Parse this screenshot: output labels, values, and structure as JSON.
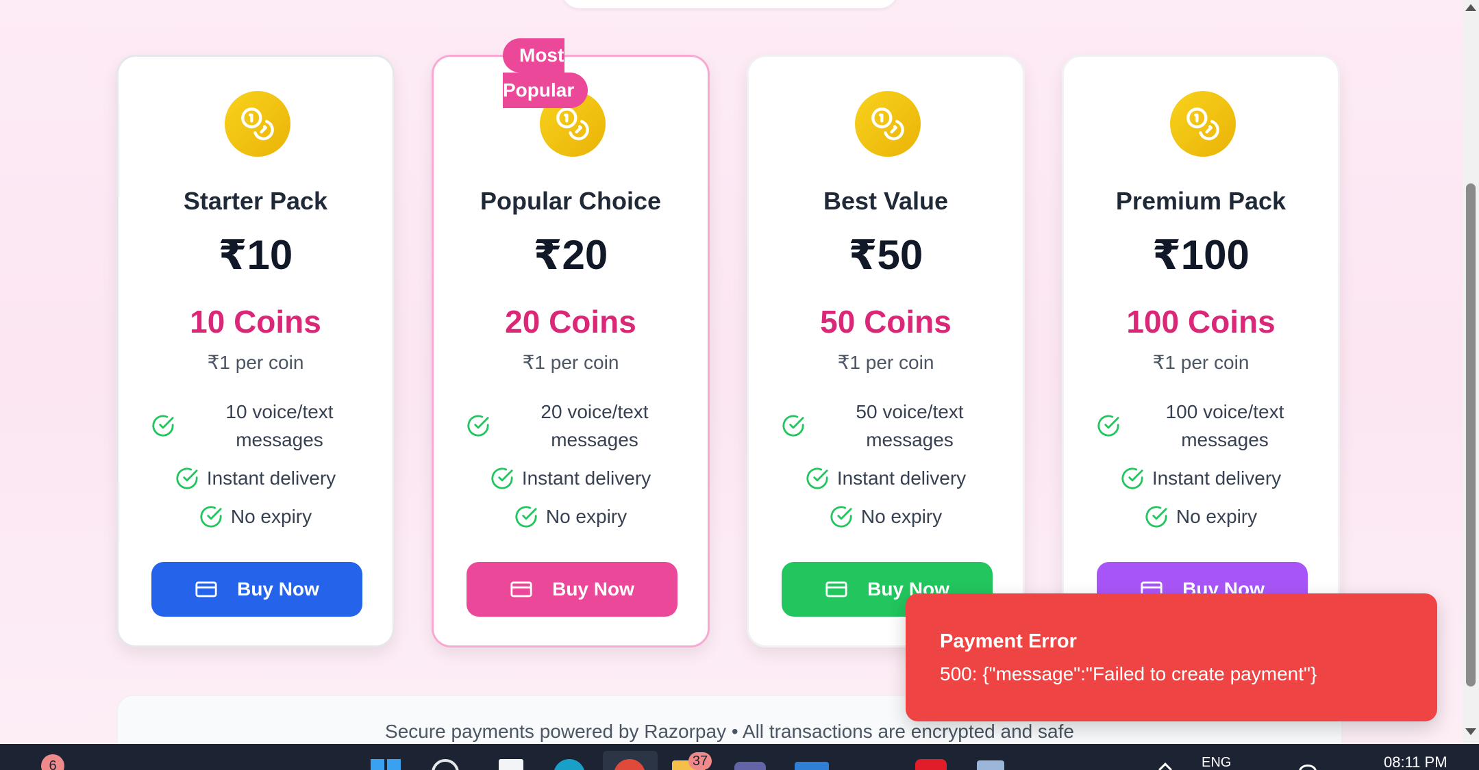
{
  "theme": {
    "accent_pink": "#ec4899",
    "coin_gold": "#eab308",
    "coins_text": "#db2777",
    "check_green": "#22c55e",
    "error_red": "#ef4444"
  },
  "badge": {
    "line1": "Most",
    "line2": "Popular"
  },
  "cards": [
    {
      "title": "Starter Pack",
      "price": "₹10",
      "coins": "10 Coins",
      "rate": "₹1 per coin",
      "features": [
        "10 voice/text messages",
        "Instant delivery",
        "No expiry"
      ],
      "button_label": "Buy Now",
      "button_color": "#2563eb",
      "icon": "coins-icon"
    },
    {
      "title": "Popular Choice",
      "price": "₹20",
      "coins": "20 Coins",
      "rate": "₹1 per coin",
      "features": [
        "20 voice/text messages",
        "Instant delivery",
        "No expiry"
      ],
      "button_label": "Buy Now",
      "button_color": "#ec4899",
      "icon": "coins-icon"
    },
    {
      "title": "Best Value",
      "price": "₹50",
      "coins": "50 Coins",
      "rate": "₹1 per coin",
      "features": [
        "50 voice/text messages",
        "Instant delivery",
        "No expiry"
      ],
      "button_label": "Buy Now",
      "button_color": "#22c55e",
      "icon": "coins-icon"
    },
    {
      "title": "Premium Pack",
      "price": "₹100",
      "coins": "100 Coins",
      "rate": "₹1 per coin",
      "features": [
        "100 voice/text messages",
        "Instant delivery",
        "No expiry"
      ],
      "button_label": "Buy Now",
      "button_color": "#a855f7",
      "icon": "coins-icon"
    }
  ],
  "footer": {
    "text": "Secure payments powered by Razorpay • All transactions are encrypted and safe"
  },
  "toast": {
    "title": "Payment Error",
    "message": "500: {\"message\":\"Failed to create payment\"}"
  },
  "taskbar": {
    "notification_count": "6",
    "folder_badge": "37",
    "language": "ENG",
    "time": "08:11 PM"
  }
}
